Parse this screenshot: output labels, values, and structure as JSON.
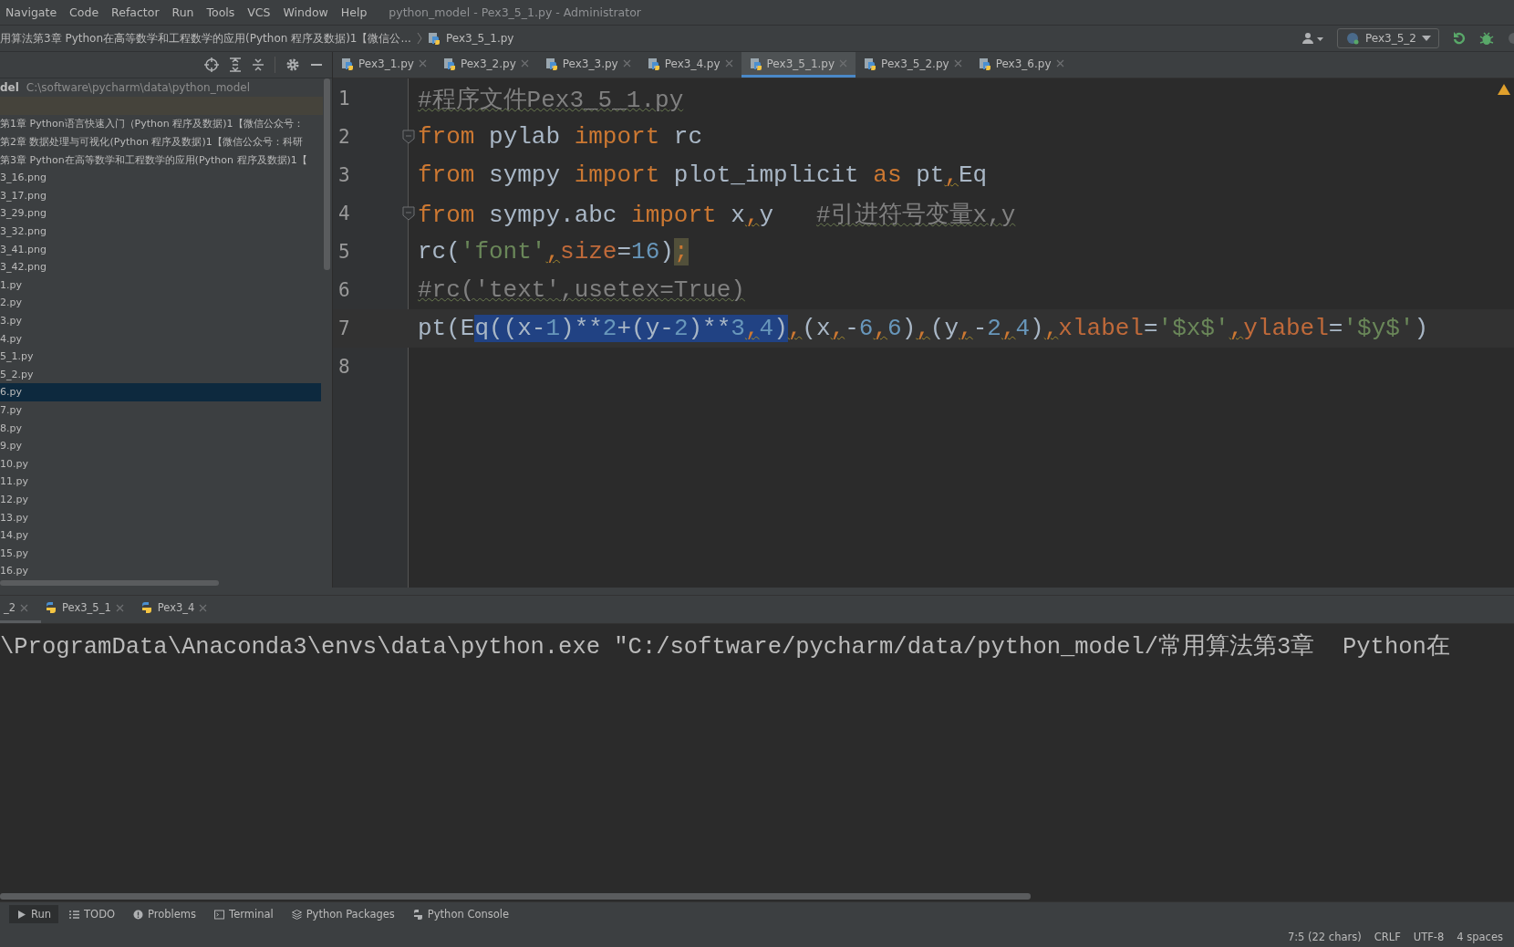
{
  "menu": {
    "items": [
      "Navigate",
      "Code",
      "Refactor",
      "Run",
      "Tools",
      "VCS",
      "Window",
      "Help"
    ],
    "title": "python_model - Pex3_5_1.py - Administrator"
  },
  "breadcrumbs": [
    "用算法第3章  Python在高等数学和工程数学的应用(Python 程序及数据)1【微信公...",
    "Pex3_5_1.py"
  ],
  "run_config": {
    "label": "Pex3_5_2"
  },
  "project": {
    "name": "del",
    "path": "C:\\software\\pycharm\\data\\python_model",
    "items": [
      {
        "label": "第1章  Python语言快速入门（Python 程序及数据)1【微信公众号：",
        "selected": false
      },
      {
        "label": "第2章  数据处理与可视化(Python 程序及数据)1【微信公众号：科研",
        "selected": false
      },
      {
        "label": "第3章  Python在高等数学和工程数学的应用(Python 程序及数据)1【",
        "selected": false
      },
      {
        "label": "3_16.png",
        "selected": false
      },
      {
        "label": "3_17.png",
        "selected": false
      },
      {
        "label": "3_29.png",
        "selected": false
      },
      {
        "label": "3_32.png",
        "selected": false
      },
      {
        "label": "3_41.png",
        "selected": false
      },
      {
        "label": "3_42.png",
        "selected": false
      },
      {
        "label": "1.py",
        "selected": false
      },
      {
        "label": "2.py",
        "selected": false
      },
      {
        "label": "3.py",
        "selected": false
      },
      {
        "label": "4.py",
        "selected": false
      },
      {
        "label": "5_1.py",
        "selected": false
      },
      {
        "label": "5_2.py",
        "selected": false
      },
      {
        "label": "6.py",
        "selected": true
      },
      {
        "label": "7.py",
        "selected": false
      },
      {
        "label": "8.py",
        "selected": false
      },
      {
        "label": "9.py",
        "selected": false
      },
      {
        "label": "10.py",
        "selected": false
      },
      {
        "label": "11.py",
        "selected": false
      },
      {
        "label": "12.py",
        "selected": false
      },
      {
        "label": "13.py",
        "selected": false
      },
      {
        "label": "14.py",
        "selected": false
      },
      {
        "label": "15.py",
        "selected": false
      },
      {
        "label": "16.py",
        "selected": false
      }
    ]
  },
  "tabs": [
    {
      "label": "Pex3_1.py",
      "selected": false
    },
    {
      "label": "Pex3_2.py",
      "selected": false
    },
    {
      "label": "Pex3_3.py",
      "selected": false
    },
    {
      "label": "Pex3_4.py",
      "selected": false
    },
    {
      "label": "Pex3_5_1.py",
      "selected": true
    },
    {
      "label": "Pex3_5_2.py",
      "selected": false
    },
    {
      "label": "Pex3_6.py",
      "selected": false
    }
  ],
  "code": {
    "lines": [
      {
        "number": "1",
        "current": false,
        "fold": false,
        "tokens": [
          {
            "text": "#程序文件Pex3_5_1.py",
            "kind": "comment"
          }
        ]
      },
      {
        "number": "2",
        "current": false,
        "fold": true,
        "tokens": [
          {
            "text": "from",
            "kind": "keyword"
          },
          {
            "text": " pylab ",
            "kind": "plain"
          },
          {
            "text": "import",
            "kind": "keyword"
          },
          {
            "text": " rc",
            "kind": "plain"
          }
        ]
      },
      {
        "number": "3",
        "current": false,
        "fold": false,
        "tokens": [
          {
            "text": "from",
            "kind": "keyword"
          },
          {
            "text": " sympy ",
            "kind": "plain"
          },
          {
            "text": "import",
            "kind": "keyword"
          },
          {
            "text": " plot_implicit ",
            "kind": "plain"
          },
          {
            "text": "as",
            "kind": "keyword"
          },
          {
            "text": " pt",
            "kind": "plain"
          },
          {
            "text": ",",
            "kind": "warn"
          },
          {
            "text": "Eq",
            "kind": "plain"
          }
        ]
      },
      {
        "number": "4",
        "current": false,
        "fold": true,
        "tokens": [
          {
            "text": "from",
            "kind": "keyword"
          },
          {
            "text": " sympy.abc ",
            "kind": "plain"
          },
          {
            "text": "import",
            "kind": "keyword"
          },
          {
            "text": " x",
            "kind": "plain"
          },
          {
            "text": ",",
            "kind": "warn"
          },
          {
            "text": "y   ",
            "kind": "plain"
          },
          {
            "text": "#引进符号变量x,y",
            "kind": "comment"
          }
        ]
      },
      {
        "number": "5",
        "current": false,
        "fold": false,
        "tokens": [
          {
            "text": "rc(",
            "kind": "plain"
          },
          {
            "text": "'font'",
            "kind": "string"
          },
          {
            "text": ",",
            "kind": "warn"
          },
          {
            "text": "size",
            "kind": "param"
          },
          {
            "text": "=",
            "kind": "plain"
          },
          {
            "text": "16",
            "kind": "number"
          },
          {
            "text": ")",
            "kind": "plain"
          },
          {
            "text": ";",
            "kind": "flag"
          }
        ]
      },
      {
        "number": "6",
        "current": false,
        "fold": false,
        "tokens": [
          {
            "text": "#rc('text',usetex=True)",
            "kind": "comment"
          }
        ]
      },
      {
        "number": "7",
        "current": true,
        "fold": false,
        "tokens": [
          {
            "text": "pt(E",
            "kind": "plain",
            "selected": false
          },
          {
            "text": "q((x-",
            "kind": "plain",
            "selected": true
          },
          {
            "text": "1",
            "kind": "number",
            "selected": true
          },
          {
            "text": ")**",
            "kind": "plain",
            "selected": true
          },
          {
            "text": "2",
            "kind": "number",
            "selected": true
          },
          {
            "text": "+(y-",
            "kind": "plain",
            "selected": true
          },
          {
            "text": "2",
            "kind": "number",
            "selected": true
          },
          {
            "text": ")**",
            "kind": "plain",
            "selected": true
          },
          {
            "text": "3",
            "kind": "number",
            "selected": true
          },
          {
            "text": ",",
            "kind": "warn",
            "selected": true
          },
          {
            "text": "4",
            "kind": "number",
            "selected": true
          },
          {
            "text": ")",
            "kind": "plain",
            "selected": true
          },
          {
            "text": ",",
            "kind": "warn",
            "selected": false
          },
          {
            "text": "(x",
            "kind": "plain",
            "selected": false
          },
          {
            "text": ",",
            "kind": "warn",
            "selected": false
          },
          {
            "text": "-",
            "kind": "plain",
            "selected": false
          },
          {
            "text": "6",
            "kind": "number",
            "selected": false
          },
          {
            "text": ",",
            "kind": "warn",
            "selected": false
          },
          {
            "text": "6",
            "kind": "number",
            "selected": false
          },
          {
            "text": ")",
            "kind": "plain",
            "selected": false
          },
          {
            "text": ",",
            "kind": "warn",
            "selected": false
          },
          {
            "text": "(y",
            "kind": "plain",
            "selected": false
          },
          {
            "text": ",",
            "kind": "warn",
            "selected": false
          },
          {
            "text": "-",
            "kind": "plain",
            "selected": false
          },
          {
            "text": "2",
            "kind": "number",
            "selected": false
          },
          {
            "text": ",",
            "kind": "warn",
            "selected": false
          },
          {
            "text": "4",
            "kind": "number",
            "selected": false
          },
          {
            "text": ")",
            "kind": "plain",
            "selected": false
          },
          {
            "text": ",",
            "kind": "warn",
            "selected": false
          },
          {
            "text": "xlabel",
            "kind": "param",
            "selected": false
          },
          {
            "text": "=",
            "kind": "plain",
            "selected": false
          },
          {
            "text": "'$x$'",
            "kind": "string",
            "selected": false
          },
          {
            "text": ",",
            "kind": "warn",
            "selected": false
          },
          {
            "text": "ylabel",
            "kind": "param",
            "selected": false
          },
          {
            "text": "=",
            "kind": "plain",
            "selected": false
          },
          {
            "text": "'$y$'",
            "kind": "string",
            "selected": false
          },
          {
            "text": ")",
            "kind": "plain",
            "selected": false
          }
        ]
      },
      {
        "number": "8",
        "current": false,
        "fold": false
      }
    ]
  },
  "run_tabs": [
    {
      "label": "_2",
      "selected": true
    },
    {
      "label": "Pex3_5_1",
      "selected": false
    },
    {
      "label": "Pex3_4",
      "selected": false
    }
  ],
  "console": {
    "lines": [
      "\\ProgramData\\Anaconda3\\envs\\data\\python.exe \"C:/software/pycharm/data/python_model/常用算法第3章  Python在"
    ]
  },
  "tool_tabs": [
    {
      "label": "Run",
      "kind": "run",
      "selected": true
    },
    {
      "label": "TODO",
      "kind": "todo",
      "selected": false
    },
    {
      "label": "Problems",
      "kind": "problems",
      "selected": false
    },
    {
      "label": "Terminal",
      "kind": "terminal",
      "selected": false
    },
    {
      "label": "Python Packages",
      "kind": "packages",
      "selected": false
    },
    {
      "label": "Python Console",
      "kind": "console",
      "selected": false
    }
  ],
  "status_bar": [
    "7:5 (22 chars)",
    "CRLF",
    "UTF-8",
    "4 spaces"
  ]
}
